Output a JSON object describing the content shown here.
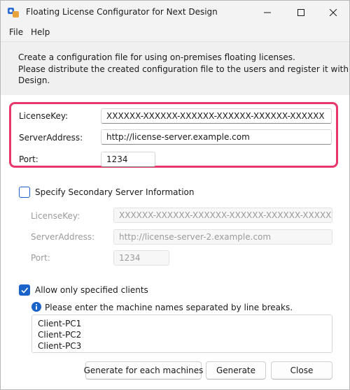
{
  "window": {
    "title": "Floating License Configurator for Next Design",
    "icon": "app-logo-icon"
  },
  "menu": {
    "items": [
      {
        "label": "File"
      },
      {
        "label": "Help"
      }
    ]
  },
  "description": {
    "lines": [
      "Create a configuration file for using on-premises floating licenses.",
      "Please distribute the created configuration file to the users and register it with Next",
      "Design."
    ]
  },
  "primary_server": {
    "license_key_label": "LicenseKey:",
    "license_key_value": "XXXXXX-XXXXXX-XXXXXX-XXXXXX-XXXXXX-XXXXXX",
    "server_address_label": "ServerAddress:",
    "server_address_value": "http://license-server.example.com",
    "port_label": "Port:",
    "port_value": "1234",
    "highlight_color": "#e8376b"
  },
  "secondary_server": {
    "checkbox_label": "Specify Secondary Server Information",
    "checked": false,
    "license_key_label": "LicenseKey:",
    "license_key_value": "XXXXXX-XXXXXX-XXXXXX-XXXXXX-XXXXXX-XXXXXX",
    "server_address_label": "ServerAddress:",
    "server_address_value": "http://license-server-2.example.com",
    "port_label": "Port:",
    "port_value": "1234"
  },
  "clients": {
    "checkbox_label": "Allow only specified clients",
    "checked": true,
    "info_text": "Please enter the machine names separated by line breaks.",
    "machines": [
      "Client-PC1",
      "Client-PC2",
      "Client-PC3"
    ]
  },
  "buttons": {
    "generate_each_label": "Generate for each machines",
    "generate_label": "Generate",
    "close_label": "Close"
  },
  "colors": {
    "accent": "#1a63c9",
    "highlight": "#e8376b"
  }
}
